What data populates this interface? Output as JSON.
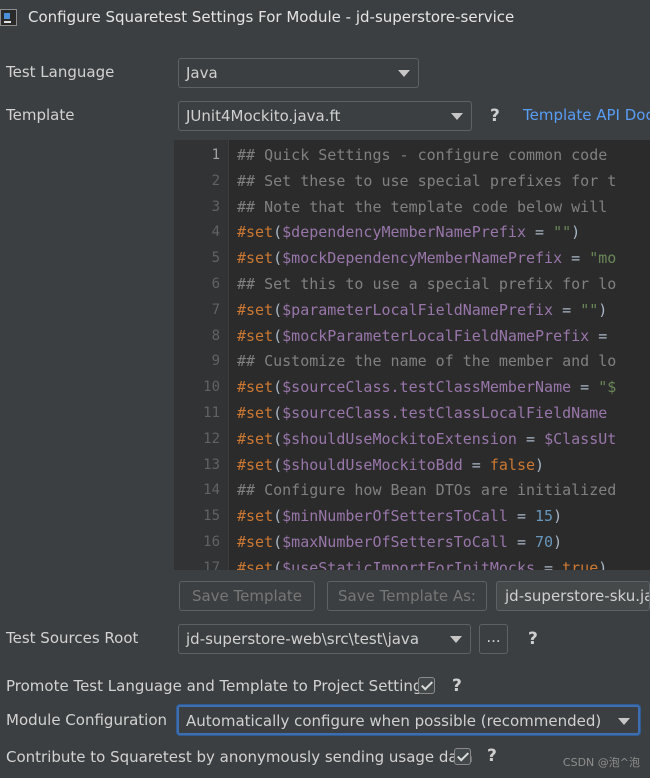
{
  "window": {
    "title": "Configure Squaretest Settings For Module - jd-superstore-service"
  },
  "test_language": {
    "label": "Test Language",
    "value": "Java"
  },
  "template": {
    "label": "Template",
    "value": "JUnit4Mockito.java.ft",
    "help": "?",
    "api_link": "Template API Doc"
  },
  "editor": {
    "lines": [
      {
        "no": "1",
        "parts": [
          {
            "t": "## Quick Settings - configure common code",
            "c": "comment"
          }
        ]
      },
      {
        "no": "2",
        "parts": [
          {
            "t": "## Set these to use special prefixes for t",
            "c": "comment"
          }
        ]
      },
      {
        "no": "3",
        "parts": [
          {
            "t": "## Note that the template code below will",
            "c": "comment"
          }
        ]
      },
      {
        "no": "4",
        "parts": [
          {
            "t": "#set",
            "c": "kw"
          },
          {
            "t": "(",
            "c": "plain"
          },
          {
            "t": "$dependencyMemberNamePrefix",
            "c": "var"
          },
          {
            "t": " = ",
            "c": "plain"
          },
          {
            "t": "\"\"",
            "c": "str"
          },
          {
            "t": ")",
            "c": "plain"
          }
        ]
      },
      {
        "no": "5",
        "parts": [
          {
            "t": "#set",
            "c": "kw"
          },
          {
            "t": "(",
            "c": "plain"
          },
          {
            "t": "$mockDependencyMemberNamePrefix",
            "c": "var"
          },
          {
            "t": " = ",
            "c": "plain"
          },
          {
            "t": "\"mo",
            "c": "str"
          }
        ]
      },
      {
        "no": "6",
        "parts": [
          {
            "t": "## Set this to use a special prefix for lo",
            "c": "comment"
          }
        ]
      },
      {
        "no": "7",
        "parts": [
          {
            "t": "#set",
            "c": "kw"
          },
          {
            "t": "(",
            "c": "plain"
          },
          {
            "t": "$parameterLocalFieldNamePrefix",
            "c": "var"
          },
          {
            "t": " = ",
            "c": "plain"
          },
          {
            "t": "\"\"",
            "c": "str"
          },
          {
            "t": ")",
            "c": "plain"
          }
        ]
      },
      {
        "no": "8",
        "parts": [
          {
            "t": "#set",
            "c": "kw"
          },
          {
            "t": "(",
            "c": "plain"
          },
          {
            "t": "$mockParameterLocalFieldNamePrefix",
            "c": "var"
          },
          {
            "t": " =",
            "c": "plain"
          }
        ]
      },
      {
        "no": "9",
        "parts": [
          {
            "t": "## Customize the name of the member and lo",
            "c": "comment"
          }
        ]
      },
      {
        "no": "10",
        "parts": [
          {
            "t": "#set",
            "c": "kw"
          },
          {
            "t": "(",
            "c": "plain"
          },
          {
            "t": "$sourceClass.testClassMemberName",
            "c": "var"
          },
          {
            "t": " = ",
            "c": "plain"
          },
          {
            "t": "\"$",
            "c": "str"
          }
        ]
      },
      {
        "no": "11",
        "parts": [
          {
            "t": "#set",
            "c": "kw"
          },
          {
            "t": "(",
            "c": "plain"
          },
          {
            "t": "$sourceClass.testClassLocalFieldName",
            "c": "var"
          }
        ]
      },
      {
        "no": "12",
        "parts": [
          {
            "t": "#set",
            "c": "kw"
          },
          {
            "t": "(",
            "c": "plain"
          },
          {
            "t": "$shouldUseMockitoExtension",
            "c": "var"
          },
          {
            "t": " = ",
            "c": "plain"
          },
          {
            "t": "$ClassUt",
            "c": "var"
          }
        ]
      },
      {
        "no": "13",
        "parts": [
          {
            "t": "#set",
            "c": "kw"
          },
          {
            "t": "(",
            "c": "plain"
          },
          {
            "t": "$shouldUseMockitoBdd",
            "c": "var"
          },
          {
            "t": " = ",
            "c": "plain"
          },
          {
            "t": "false",
            "c": "kw"
          },
          {
            "t": ")",
            "c": "plain"
          }
        ]
      },
      {
        "no": "14",
        "parts": [
          {
            "t": "## Configure how Bean DTOs are initialized",
            "c": "comment"
          }
        ]
      },
      {
        "no": "15",
        "parts": [
          {
            "t": "#set",
            "c": "kw"
          },
          {
            "t": "(",
            "c": "plain"
          },
          {
            "t": "$minNumberOfSettersToCall",
            "c": "var"
          },
          {
            "t": " = ",
            "c": "plain"
          },
          {
            "t": "15",
            "c": "num"
          },
          {
            "t": ")",
            "c": "plain"
          }
        ]
      },
      {
        "no": "16",
        "parts": [
          {
            "t": "#set",
            "c": "kw"
          },
          {
            "t": "(",
            "c": "plain"
          },
          {
            "t": "$maxNumberOfSettersToCall",
            "c": "var"
          },
          {
            "t": " = ",
            "c": "plain"
          },
          {
            "t": "70",
            "c": "num"
          },
          {
            "t": ")",
            "c": "plain"
          }
        ]
      },
      {
        "no": "17",
        "parts": [
          {
            "t": "#set",
            "c": "kw"
          },
          {
            "t": "(",
            "c": "plain"
          },
          {
            "t": "$useStaticImportForInitMocks",
            "c": "var"
          },
          {
            "t": " = ",
            "c": "plain"
          },
          {
            "t": "true",
            "c": "kw"
          },
          {
            "t": ")",
            "c": "plain"
          }
        ]
      }
    ]
  },
  "buttons": {
    "save_template": "Save Template",
    "save_template_as": "Save Template As:",
    "save_as_value": "jd-superstore-sku.java"
  },
  "test_sources_root": {
    "label": "Test Sources Root",
    "value": "jd-superstore-web\\src\\test\\java",
    "browse": "...",
    "help": "?"
  },
  "promote": {
    "label": "Promote Test Language and Template to Project Settings",
    "checked": true,
    "help": "?"
  },
  "module_configuration": {
    "label": "Module Configuration",
    "value": "Automatically configure when possible (recommended)"
  },
  "contribute": {
    "label": "Contribute to Squaretest by anonymously sending usage data",
    "checked": true,
    "help": "?"
  },
  "watermark": "CSDN @泡^泡"
}
